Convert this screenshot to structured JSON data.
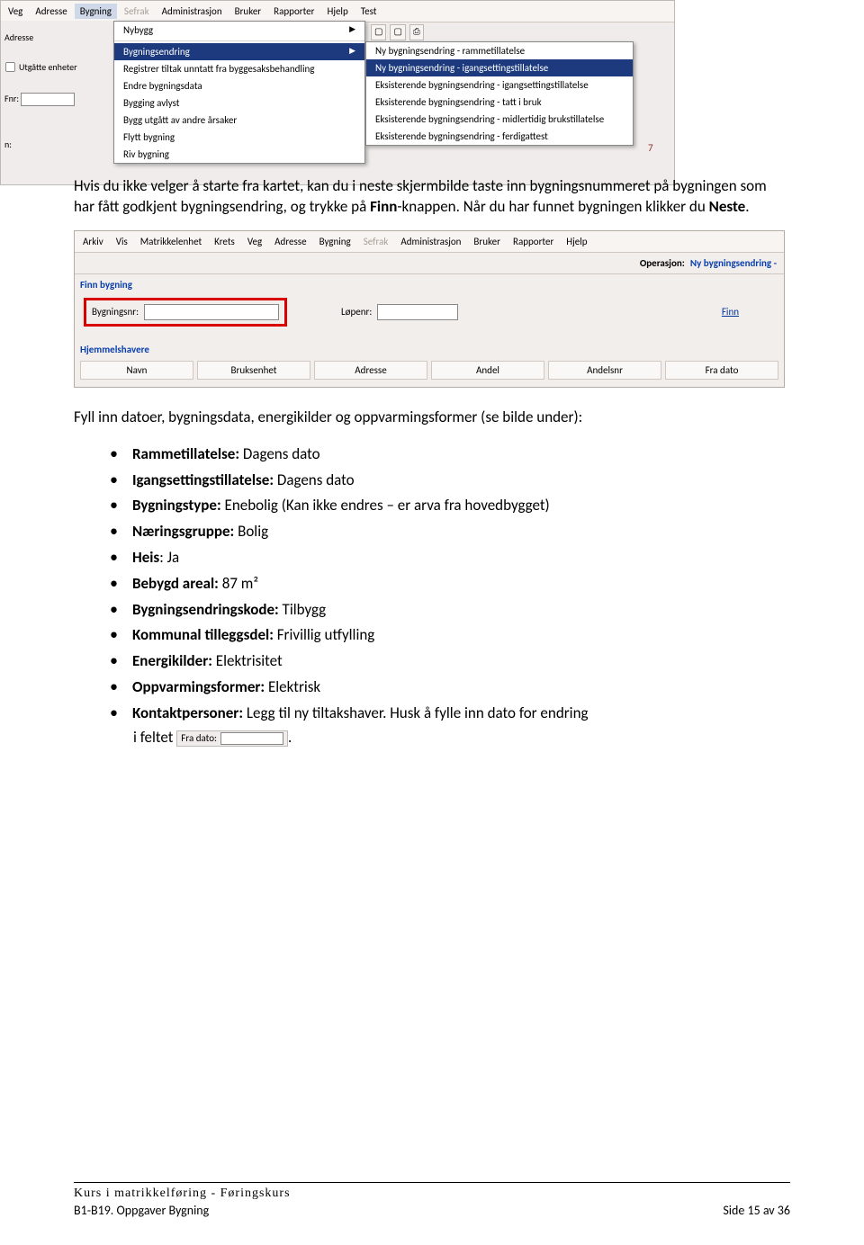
{
  "scr1": {
    "menubar": [
      "Veg",
      "Adresse",
      "Bygning",
      "Sefrak",
      "Administrasjon",
      "Bruker",
      "Rapporter",
      "Hjelp",
      "Test"
    ],
    "adresse_label": "Adresse",
    "utgatte_label": "Utgåtte enheter",
    "fnr_label": "Fnr:",
    "n_label": "n:",
    "dropdown1": [
      {
        "label": "Nybygg",
        "arrow": true
      },
      {
        "label": "Bygningsendring",
        "arrow": true,
        "sel": true
      },
      {
        "label": "Registrer tiltak unntatt fra byggesaksbehandling"
      },
      {
        "label": "Endre bygningsdata"
      },
      {
        "label": "Bygging avlyst"
      },
      {
        "label": "Bygg utgått av andre årsaker"
      },
      {
        "label": "Flytt bygning"
      },
      {
        "label": "Riv bygning"
      }
    ],
    "dropdown2": [
      {
        "label": "Ny bygningsendring - rammetillatelse"
      },
      {
        "label": "Ny bygningsendring - igangsettingstillatelse",
        "sel": true
      },
      {
        "label": "Eksisterende bygningsendring - igangsettingstillatelse"
      },
      {
        "label": "Eksisterende bygningsendring - tatt i bruk"
      },
      {
        "label": "Eksisterende bygningsendring - midlertidig brukstillatelse"
      },
      {
        "label": "Eksisterende bygningsendring - ferdigattest"
      }
    ],
    "decor": "7"
  },
  "para1_a": "Hvis du ikke velger å starte fra kartet, kan du i neste skjermbilde taste inn bygningsnummeret på bygningen som har fått godkjent bygningsendring, og trykke på ",
  "para1_b": "Finn",
  "para1_c": "-knappen. Når du har funnet bygningen klikker du ",
  "para1_d": "Neste",
  "para1_e": ".",
  "scr2": {
    "menubar": [
      "Arkiv",
      "Vis",
      "Matrikkelenhet",
      "Krets",
      "Veg",
      "Adresse",
      "Bygning",
      "Sefrak",
      "Administrasjon",
      "Bruker",
      "Rapporter",
      "Hjelp"
    ],
    "op_label": "Operasjon:",
    "op_value": "Ny bygningsendring -",
    "sec1": "Finn bygning",
    "bygningsnr_label": "Bygningsnr:",
    "lopenr_label": "Løpenr:",
    "finn": "Finn",
    "sec2": "Hjemmelshavere",
    "cols": [
      "Navn",
      "Bruksenhet",
      "Adresse",
      "Andel",
      "Andelsnr",
      "Fra dato"
    ]
  },
  "para2": "Fyll inn datoer, bygningsdata, energikilder og oppvarmingsformer (se bilde under):",
  "bullets": [
    {
      "b": "Rammetillatelse:",
      "t": " Dagens dato"
    },
    {
      "b": "Igangsettingstillatelse:",
      "t": " Dagens dato"
    },
    {
      "b": "Bygningstype:",
      "t": " Enebolig (Kan ikke endres – er arva fra hovedbygget)"
    },
    {
      "b": "Næringsgruppe:",
      "t": " Bolig"
    },
    {
      "b": "Heis",
      "t": ": Ja"
    },
    {
      "b": "Bebygd areal:",
      "t": " 87 m²"
    },
    {
      "b": "Bygningsendringskode:",
      "t": " Tilbygg"
    },
    {
      "b": "Kommunal tilleggsdel:",
      "t": " Frivillig utfylling"
    },
    {
      "b": "Energikilder:",
      "t": " Elektrisitet"
    },
    {
      "b": "Oppvarmingsformer:",
      "t": " Elektrisk"
    },
    {
      "b": "Kontaktpersoner:",
      "t": " Legg til ny tiltakshaver. Husk å fylle inn dato for endring"
    }
  ],
  "last_line_prefix": "i feltet",
  "inline_field_label": "Fra dato:",
  "last_line_suffix": ".",
  "footer": {
    "course": "Kurs i matrikkelføring - Føringskurs",
    "left": "B1-B19. Oppgaver Bygning",
    "right": "Side 15 av 36"
  }
}
